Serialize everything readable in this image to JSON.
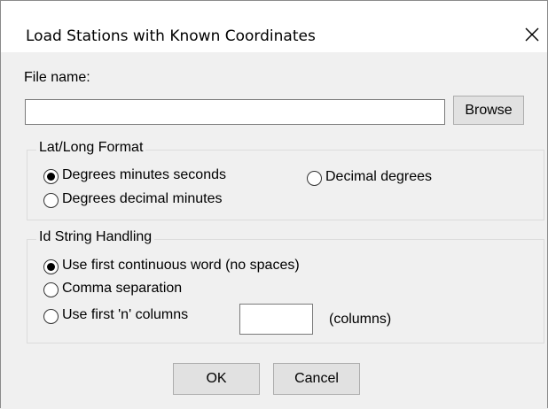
{
  "window": {
    "title": "Load Stations with Known Coordinates",
    "close_icon": "close-icon"
  },
  "file": {
    "label": "File name:",
    "value": "",
    "browse_label": "Browse"
  },
  "latlong": {
    "legend": "Lat/Long Format",
    "options": [
      {
        "label": "Degrees minutes seconds",
        "selected": true
      },
      {
        "label": "Degrees decimal minutes",
        "selected": false
      },
      {
        "label": "Decimal degrees",
        "selected": false
      }
    ]
  },
  "idstring": {
    "legend": "Id String Handling",
    "options": [
      {
        "label": "Use first continuous word (no spaces)",
        "selected": true
      },
      {
        "label": "Comma separation",
        "selected": false
      },
      {
        "label": "Use first 'n' columns",
        "selected": false
      }
    ],
    "columns_value": "",
    "columns_suffix": "(columns)"
  },
  "buttons": {
    "ok_label": "OK",
    "cancel_label": "Cancel"
  }
}
